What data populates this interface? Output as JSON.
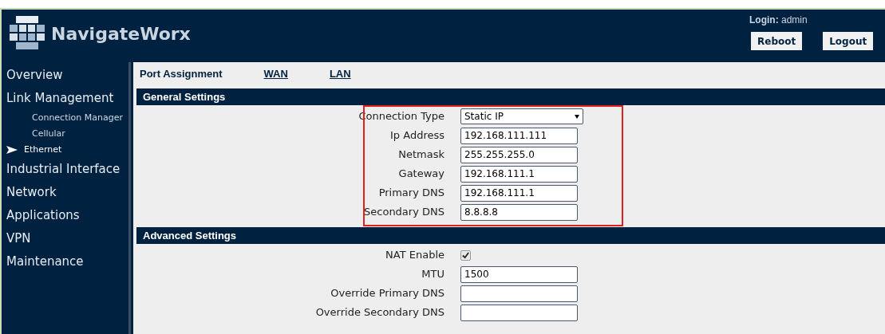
{
  "header": {
    "brand": "NavigateWorx",
    "login": "**Login:** admin",
    "buttons": [
      "Reboot",
      "Logout"
    ]
  },
  "sidebar": {
    "items": [
      {
        "label": "Overview",
        "selected": false
      },
      {
        "label": "Link Management",
        "selected": false,
        "children": [
          {
            "label": "Connection Manager",
            "selected": false
          },
          {
            "label": "Cellular",
            "selected": false
          },
          {
            "label": "Ethernet",
            "selected": true
          }
        ]
      },
      {
        "label": "Industrial Interface",
        "selected": false
      },
      {
        "label": "Network",
        "selected": false
      },
      {
        "label": "Applications",
        "selected": false
      },
      {
        "label": "VPN",
        "selected": false
      },
      {
        "label": "Maintenance",
        "selected": false
      }
    ]
  },
  "tabs": [
    {
      "label": "Port Assignment",
      "selected": true
    },
    {
      "label": "WAN",
      "selected": false
    },
    {
      "label": "LAN",
      "selected": false
    }
  ],
  "sections": [
    {
      "title": "General Settings",
      "highlighted": true,
      "fields": [
        {
          "kind": "select",
          "label": "Connection Type",
          "value": "Static IP"
        },
        {
          "kind": "text",
          "label": "Ip Address",
          "value": "192.168.111.111"
        },
        {
          "kind": "text",
          "label": "Netmask",
          "value": "255.255.255.0"
        },
        {
          "kind": "text",
          "label": "Gateway",
          "value": "192.168.111.1"
        },
        {
          "kind": "text",
          "label": "Primary DNS",
          "value": "192.168.111.1"
        },
        {
          "kind": "text",
          "label": "Secondary DNS",
          "value": "8.8.8.8"
        }
      ]
    },
    {
      "title": "Advanced Settings",
      "highlighted": false,
      "fields": [
        {
          "kind": "checkbox",
          "label": "NAT Enable",
          "checked": true
        },
        {
          "kind": "text",
          "label": "MTU",
          "value": "1500"
        },
        {
          "kind": "text",
          "label": "Override Primary DNS"
        },
        {
          "kind": "text",
          "label": "Override Secondary DNS"
        }
      ]
    }
  ]
}
